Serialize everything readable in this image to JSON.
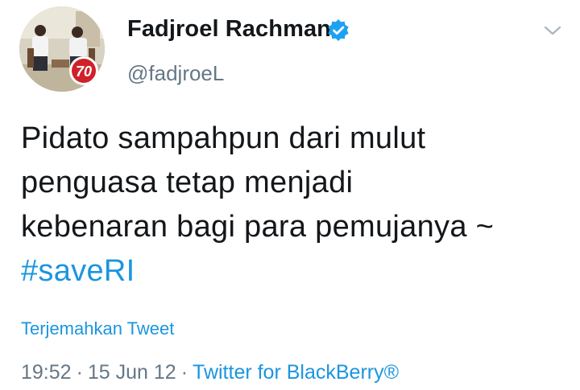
{
  "user": {
    "display_name": "Fadjroel Rachman",
    "handle": "@fadjroeL",
    "verified_icon": "verified-badge-icon",
    "badge_text": "70"
  },
  "tweet": {
    "lines": [
      "Pidato sampahpun dari mulut",
      "penguasa tetap menjadi",
      "kebenaran bagi para pemujanya ~"
    ],
    "hashtag": "#saveRI",
    "translate_label": "Terjemahkan Tweet",
    "time": "19:52",
    "separator": "·",
    "date": "15 Jun 12",
    "source": "Twitter for BlackBerry®"
  },
  "colors": {
    "link": "#1b95e0",
    "muted": "#657786",
    "text": "#14171a",
    "badge_red": "#d0202a"
  },
  "icons": {
    "menu": "chevron-down-icon"
  }
}
